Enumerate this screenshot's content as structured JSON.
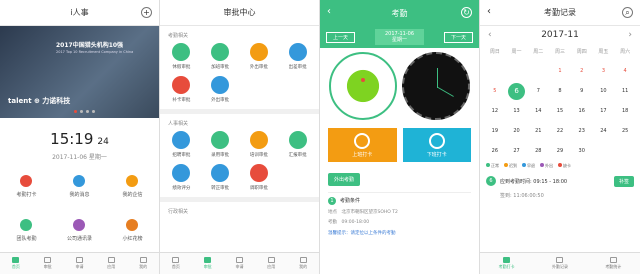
{
  "p1": {
    "title": "i人事",
    "banner_title": "2017中国猎头机构10强",
    "banner_sub": "2017 Top 10 Recruitment Company in China",
    "brand": "talent ⊕ 力诺科技",
    "time": "15:19",
    "seconds": "24",
    "date": "2017-11-06 星期一",
    "grid": [
      {
        "label": "考勤打卡",
        "icon": "clock-icon",
        "color": "#e74c3c"
      },
      {
        "label": "我的消息",
        "icon": "message-icon",
        "color": "#3498db"
      },
      {
        "label": "我的企信",
        "icon": "envelope-icon",
        "color": "#f39c12"
      },
      {
        "label": "团队考勤",
        "icon": "team-icon",
        "color": "#3dbf82"
      },
      {
        "label": "公司通讯录",
        "icon": "contacts-icon",
        "color": "#9b59b6"
      },
      {
        "label": "小红花榜",
        "icon": "flower-icon",
        "color": "#e67e22"
      }
    ],
    "tabs": [
      "首页",
      "审批",
      "申请",
      "应用",
      "我的"
    ]
  },
  "p2": {
    "title": "审批中心",
    "sections": [
      {
        "name": "考勤相关",
        "items": [
          {
            "label": "休假审批",
            "color": "#3dbf82"
          },
          {
            "label": "加班审批",
            "color": "#3dbf82"
          },
          {
            "label": "外出审批",
            "color": "#f39c12"
          },
          {
            "label": "出差审批",
            "color": "#3498db"
          },
          {
            "label": "补卡审批",
            "color": "#e74c3c"
          },
          {
            "label": "外出审批",
            "color": "#3498db"
          }
        ]
      },
      {
        "name": "人事相关",
        "items": [
          {
            "label": "招聘审批",
            "color": "#3498db"
          },
          {
            "label": "录用审批",
            "color": "#3dbf82"
          },
          {
            "label": "培训审批",
            "color": "#f39c12"
          },
          {
            "label": "汇报审批",
            "color": "#3dbf82"
          },
          {
            "label": "绩效评分",
            "color": "#3498db"
          },
          {
            "label": "转正审批",
            "color": "#3498db"
          },
          {
            "label": "调职审批",
            "color": "#e74c3c"
          }
        ]
      },
      {
        "name": "行政相关",
        "items": []
      }
    ],
    "tabs": [
      "首页",
      "审批",
      "申请",
      "应用",
      "我的"
    ]
  },
  "p3": {
    "title": "考勤",
    "prev": "上一天",
    "next": "下一天",
    "day_date": "2017-11-06",
    "day_week": "星期一",
    "card1": "上班打卡",
    "card2": "下班打卡",
    "out_btn": "外出考勤",
    "cond_num": "1",
    "cond_title": "考勤条件",
    "row1_label": "地点",
    "row1_val": "北京市朝阳区望京SOHO T2",
    "row2_label": "考勤",
    "row2_val": "09:00-18:00",
    "link": "温馨提示：请定位以上条件的考勤"
  },
  "p4": {
    "title": "考勤记录",
    "month": "2017-11",
    "weekdays": [
      "周日",
      "周一",
      "周二",
      "周三",
      "周四",
      "周五",
      "周六"
    ],
    "days": [
      "",
      "",
      "",
      "1",
      "2",
      "3",
      "4",
      "5",
      "6",
      "7",
      "8",
      "9",
      "10",
      "11",
      "12",
      "13",
      "14",
      "15",
      "16",
      "17",
      "18",
      "19",
      "20",
      "21",
      "22",
      "23",
      "24",
      "25",
      "26",
      "27",
      "28",
      "29",
      "30",
      "",
      ""
    ],
    "red_days": [
      "1",
      "2",
      "3",
      "5",
      "4"
    ],
    "today": "6",
    "legend": [
      {
        "label": "正常",
        "color": "#3dbf82"
      },
      {
        "label": "迟到",
        "color": "#f39c12"
      },
      {
        "label": "早退",
        "color": "#3498db"
      },
      {
        "label": "外出",
        "color": "#9b59b6"
      },
      {
        "label": "缺卡",
        "color": "#e74c3c"
      }
    ],
    "rec_num": "6",
    "rec_t1": "应到考勤时间: 09:15 - 18:00",
    "rec_t2": "签到: 11:06:00:50",
    "rec_btn": "补签",
    "tabs": [
      "考勤打卡",
      "外勤记录",
      "考勤统计"
    ]
  }
}
